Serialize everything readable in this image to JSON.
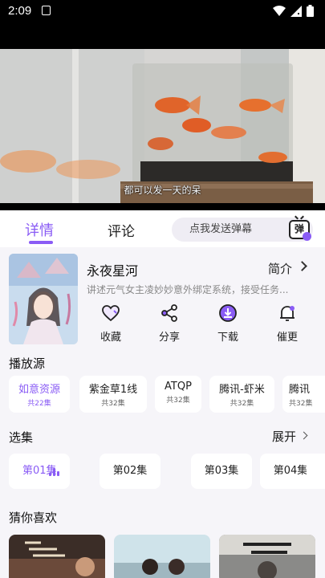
{
  "status_bar": {
    "time": "2:09"
  },
  "video": {
    "subtitle": "都可以发一天的呆"
  },
  "tabs": {
    "detail": "详情",
    "comments": "评论"
  },
  "danmaku": {
    "placeholder": "点我发送弹幕",
    "button_label": "弹"
  },
  "show": {
    "title": "永夜星河",
    "intro_label": "简介",
    "summary": "讲述元气女主凌妙妙意外绑定系统，接受任务..."
  },
  "actions": [
    {
      "label": "收藏",
      "icon": "heart-icon"
    },
    {
      "label": "分享",
      "icon": "share-icon"
    },
    {
      "label": "下载",
      "icon": "download-icon"
    },
    {
      "label": "催更",
      "icon": "bell-icon"
    }
  ],
  "sources": {
    "title": "播放源",
    "items": [
      {
        "name": "如意资源",
        "count": "共22集",
        "active": true
      },
      {
        "name": "紫金草1线",
        "count": "共32集"
      },
      {
        "name": "ATQP",
        "count": "共32集"
      },
      {
        "name": "腾讯-虾米",
        "count": "共32集"
      },
      {
        "name": "腾讯",
        "count": "共32集"
      }
    ]
  },
  "episodes": {
    "title": "选集",
    "expand_label": "展开",
    "items": [
      {
        "label": "第01集",
        "active": true
      },
      {
        "label": "第02集"
      },
      {
        "label": "第03集"
      },
      {
        "label": "第04集"
      }
    ]
  },
  "recommendations": {
    "title": "猜你喜欢"
  },
  "colors": {
    "accent": "#8a5cf5",
    "background": "#f6f5f9"
  }
}
